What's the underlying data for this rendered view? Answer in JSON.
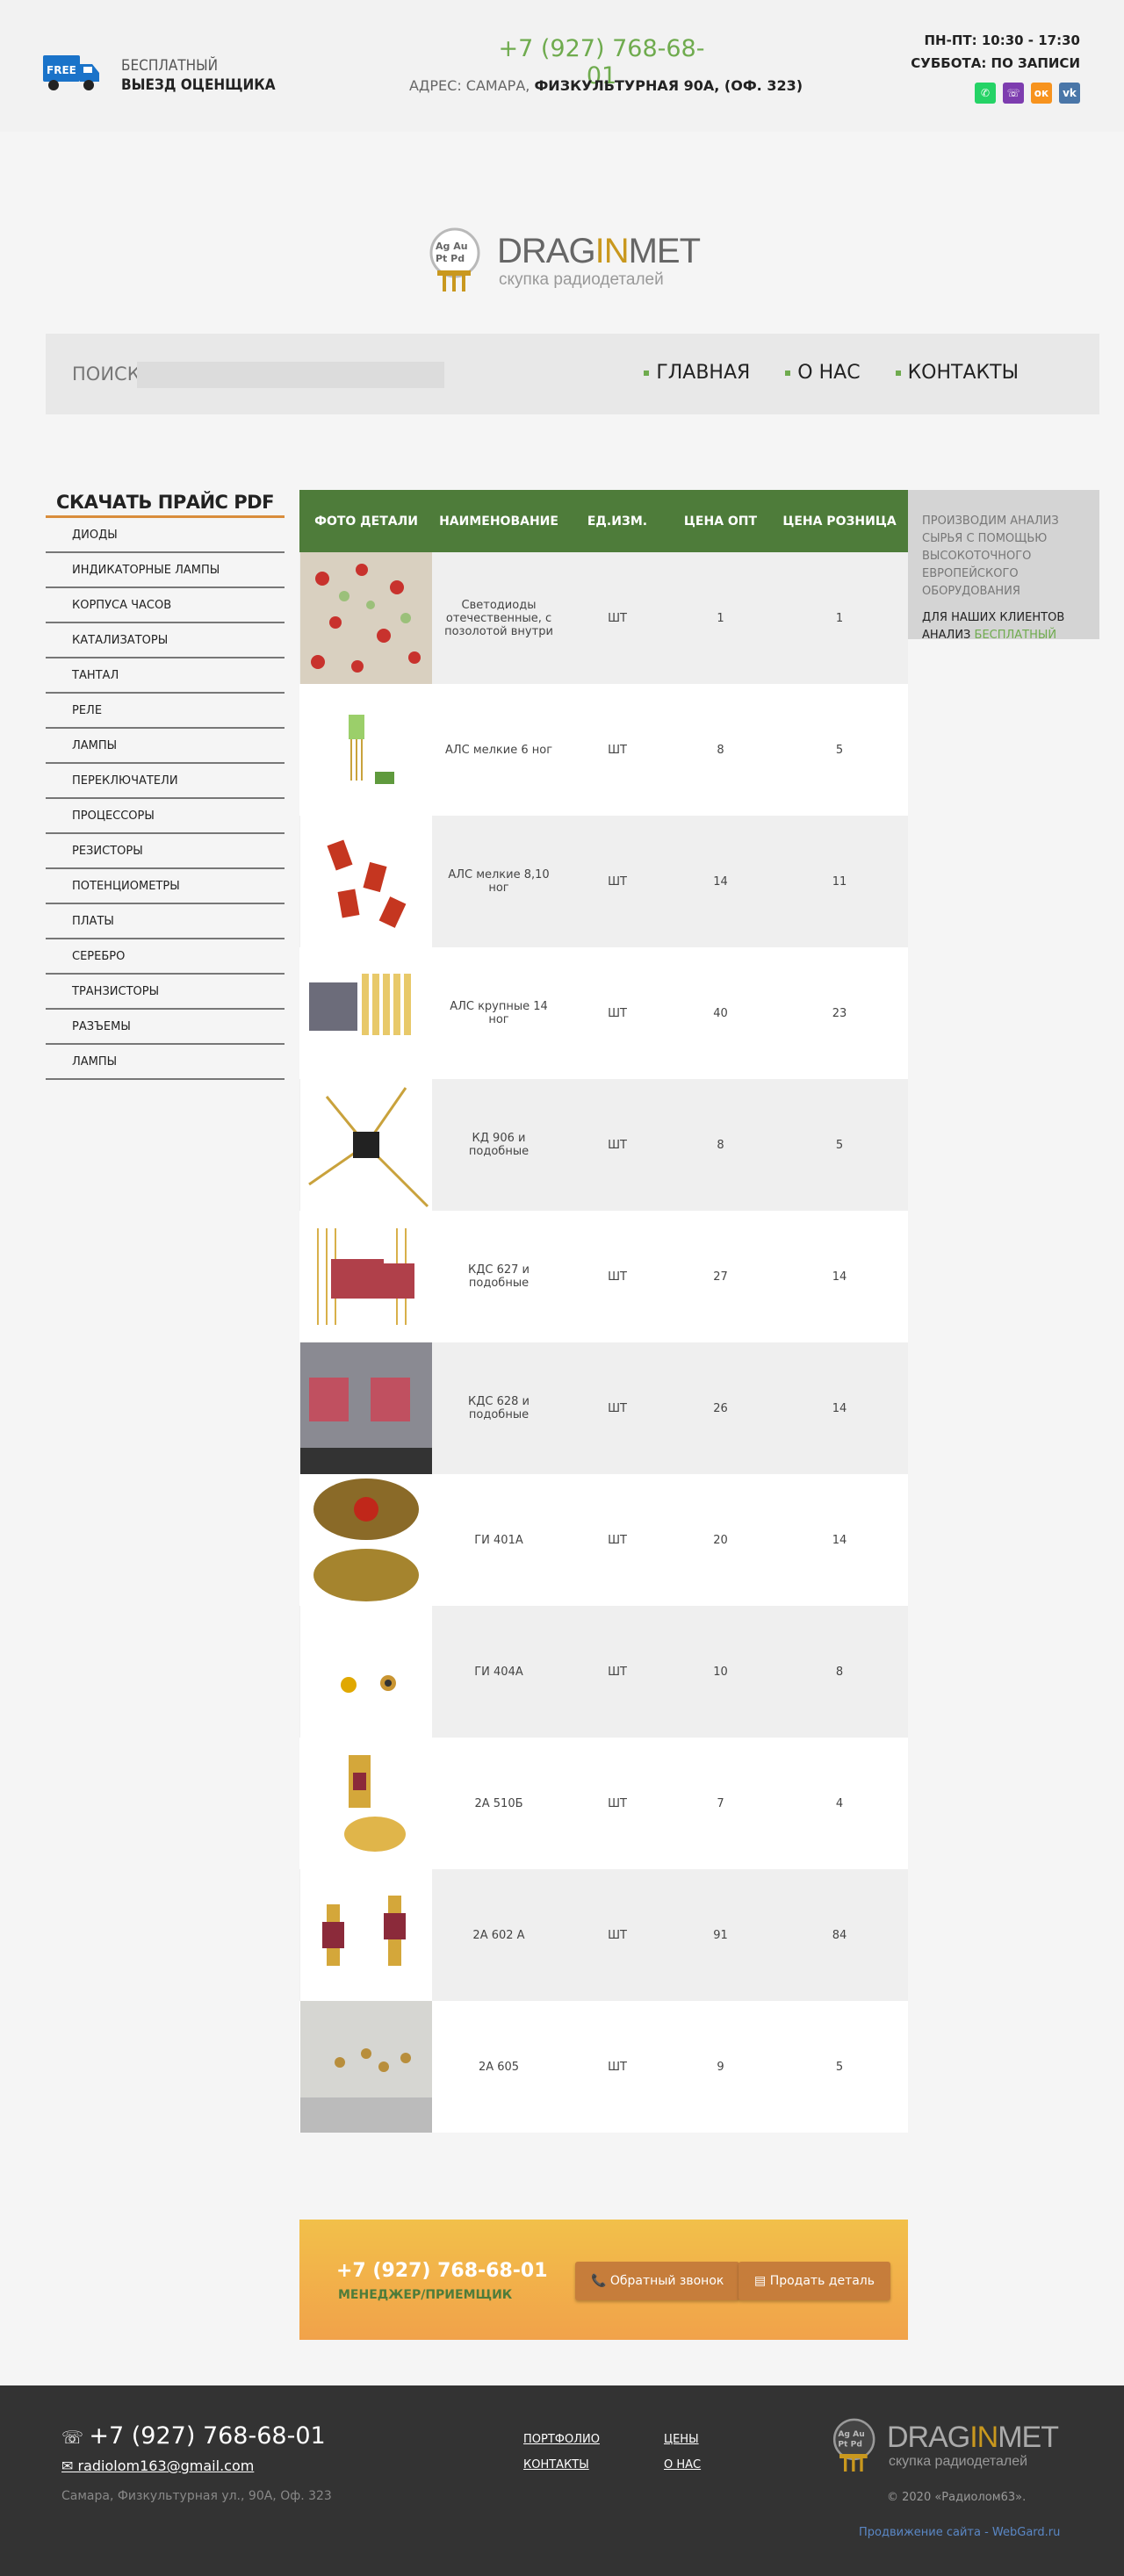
{
  "header": {
    "free_line1": "БЕСПЛАТНЫЙ",
    "free_line2": "ВЫЕЗД ОЦЕНЩИКА",
    "truck_badge": "FREE",
    "phone": "+7 (927) 768-68-01",
    "address_label": "АДРЕС: САМАРА, ",
    "address_value": "ФИЗКУЛЬТУРНАЯ 90А, (ОФ. 323)",
    "hours_line1": "ПН-ПТ: 10:30 - 17:30",
    "hours_line2": "СУББОТА: ПО ЗАПИСИ",
    "socials": [
      "whatsapp-icon",
      "viber-icon",
      "odnoklassniki-icon",
      "vk-icon"
    ]
  },
  "logo": {
    "elements": "Ag Au Pt Pd",
    "name_part1": "DRAG",
    "name_part2": "IN",
    "name_part3": "MET",
    "tagline": "скупка радиодеталей"
  },
  "nav": {
    "search_label": "ПОИСК:",
    "search_placeholder": "",
    "items": [
      "ГЛАВНАЯ",
      "О НАС",
      "КОНТАКТЫ"
    ]
  },
  "sidebar": {
    "title": "СКАЧАТЬ ПРАЙС PDF",
    "items": [
      "ДИОДЫ",
      "ИНДИКАТОРНЫЕ ЛАМПЫ",
      "КОРПУСА ЧАСОВ",
      "КАТАЛИЗАТОРЫ",
      "ТАНТАЛ",
      "РЕЛЕ",
      "ЛАМПЫ",
      "ПЕРЕКЛЮЧАТЕЛИ",
      "ПРОЦЕССОРЫ",
      "РЕЗИСТОРЫ",
      "ПОТЕНЦИОМЕТРЫ",
      "ПЛАТЫ",
      "СЕРЕБРО",
      "ТРАНЗИСТОРЫ",
      "РАЗЪЕМЫ",
      "ЛАМПЫ"
    ]
  },
  "table": {
    "headers": [
      "ФОТО ДЕТАЛИ",
      "НАИМЕНОВАНИЕ",
      "ЕД.ИЗМ.",
      "ЦЕНА ОПТ",
      "ЦЕНА РОЗНИЦА"
    ],
    "rows": [
      {
        "name": "Светодиоды отечественные, с позолотой внутри",
        "unit": "ШТ",
        "opt": "1",
        "retail": "1"
      },
      {
        "name": "АЛС мелкие 6 ног",
        "unit": "ШТ",
        "opt": "8",
        "retail": "5"
      },
      {
        "name": "АЛС мелкие 8,10 ног",
        "unit": "ШТ",
        "opt": "14",
        "retail": "11"
      },
      {
        "name": "АЛС крупные 14 ног",
        "unit": "ШТ",
        "opt": "40",
        "retail": "23"
      },
      {
        "name": "КД 906 и подобные",
        "unit": "ШТ",
        "opt": "8",
        "retail": "5"
      },
      {
        "name": "КДС 627 и подобные",
        "unit": "ШТ",
        "opt": "27",
        "retail": "14"
      },
      {
        "name": "КДС 628 и подобные",
        "unit": "ШТ",
        "opt": "26",
        "retail": "14"
      },
      {
        "name": "ГИ 401А",
        "unit": "ШТ",
        "opt": "20",
        "retail": "14"
      },
      {
        "name": "ГИ 404А",
        "unit": "ШТ",
        "opt": "10",
        "retail": "8"
      },
      {
        "name": "2А 510Б",
        "unit": "ШТ",
        "opt": "7",
        "retail": "4"
      },
      {
        "name": "2А 602 А",
        "unit": "ШТ",
        "opt": "91",
        "retail": "84"
      },
      {
        "name": "2А 605",
        "unit": "ШТ",
        "opt": "9",
        "retail": "5"
      }
    ]
  },
  "infobox": {
    "line1": "ПРОИЗВОДИМ АНАЛИЗ СЫРЬЯ С ПОМОЩЬЮ ВЫСОКОТОЧНОГО ЕВРОПЕЙСКОГО ОБОРУДОВАНИЯ",
    "line2": "ДЛЯ НАШИХ КЛИЕНТОВ АНАЛИЗ ",
    "line2_green": "БЕСПЛАТНЫЙ"
  },
  "cta": {
    "phone": "+7 (927) 768-68-01",
    "role": "МЕНЕДЖЕР/ПРИЕМЩИК",
    "btn_call": "Обратный звонок",
    "btn_sell": "Продать деталь"
  },
  "footer": {
    "phone": "+7 (927) 768-68-01",
    "email": "radiolom163@gmail.com",
    "address": "Самара, Физкультурная ул., 90А, Оф. 323",
    "links": [
      "ПОРТФОЛИО",
      "ЦЕНЫ",
      "КОНТАКТЫ",
      "О НАС"
    ],
    "copyright": "© 2020 «Радиолом63».",
    "promo": "Продвижение сайта - WebGard.ru"
  },
  "colors": {
    "accent_green": "#6fab4e",
    "table_header": "#4e7c3a",
    "logo_gold": "#c9981e",
    "cta_orange": "#f1a24a"
  }
}
